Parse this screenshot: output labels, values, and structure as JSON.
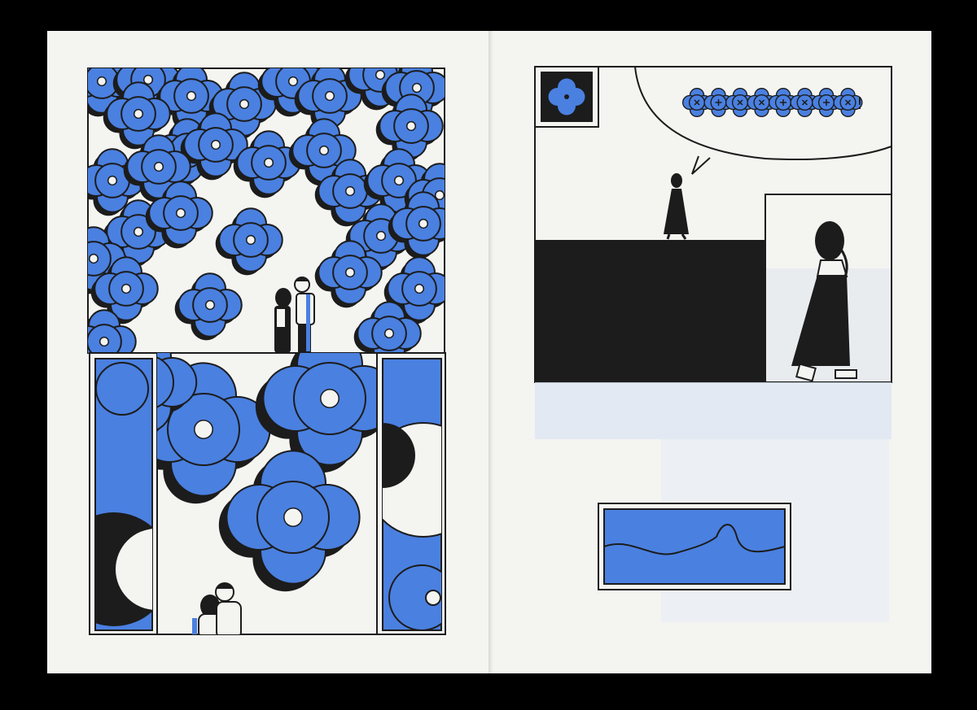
{
  "spread": {
    "colors": {
      "paper": "#f4f4f1",
      "ink": "#1c1c1c",
      "blue": "#4a80e0",
      "blue_tint": "#dde6f2",
      "background": "#000000"
    }
  },
  "right_page": {
    "speech_bubble": {
      "glyph_icons": [
        "x-flower-icon",
        "plus-flower-icon",
        "x-flower-icon",
        "x-flower-icon",
        "plus-flower-icon",
        "x-flower-icon",
        "plus-flower-icon",
        "x-flower-icon"
      ],
      "exclamation": "!"
    }
  }
}
